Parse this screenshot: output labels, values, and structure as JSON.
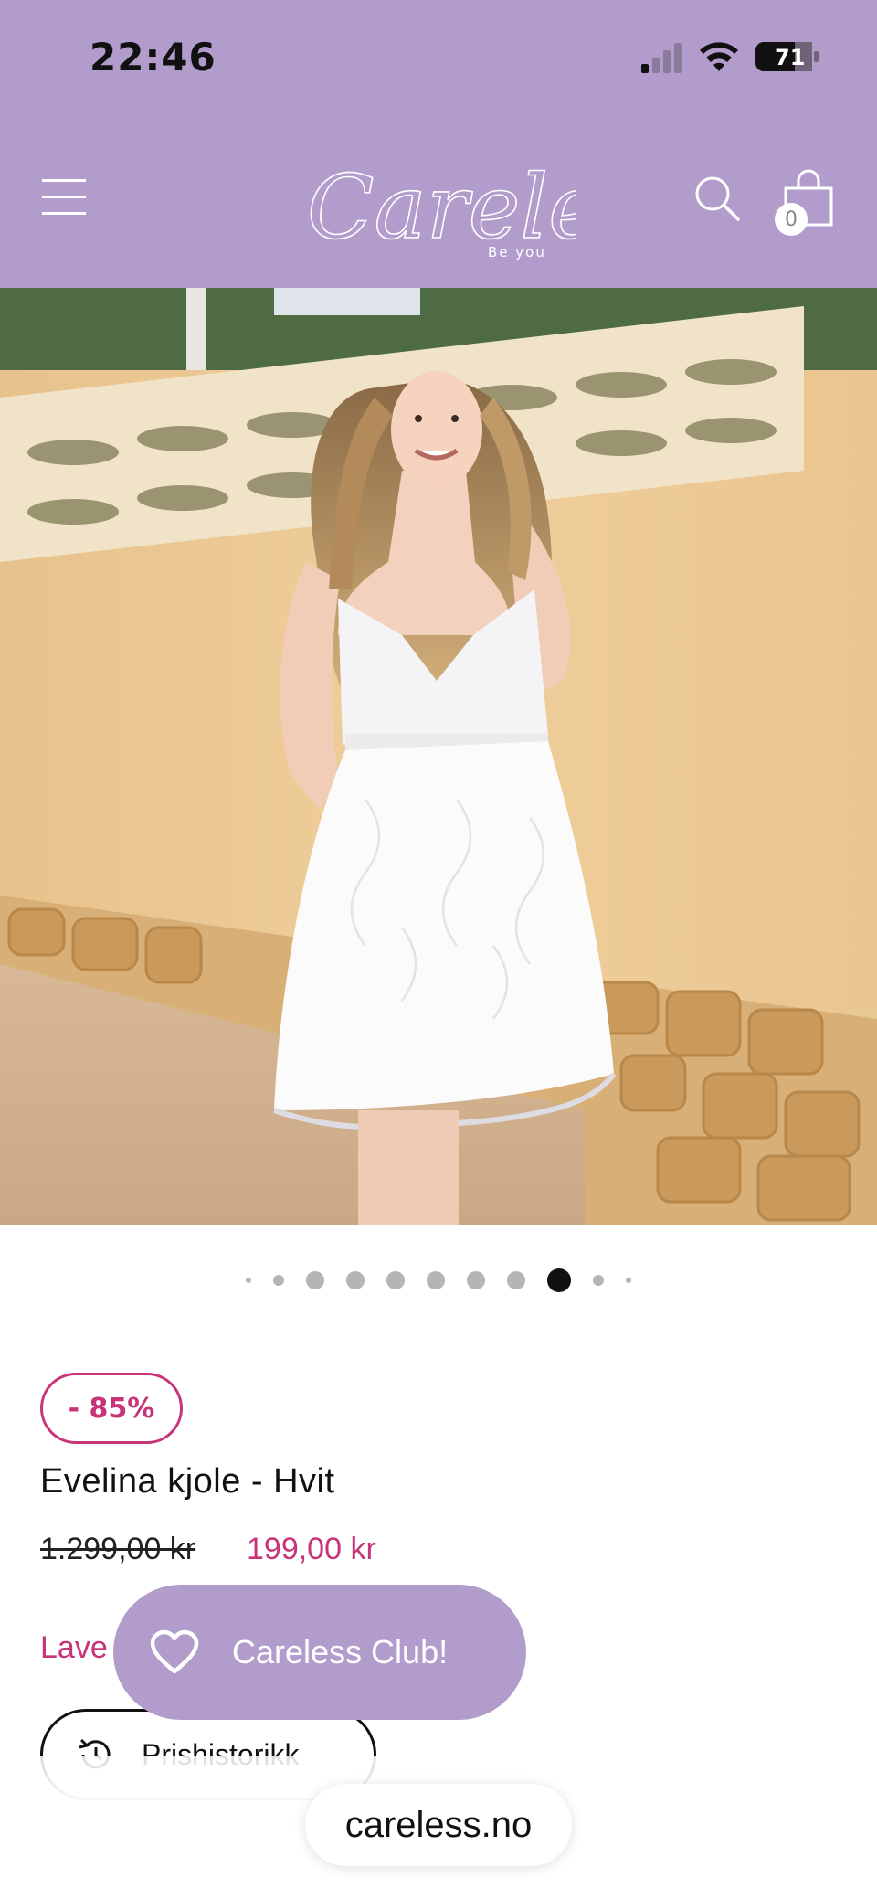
{
  "status_bar": {
    "time": "22:46",
    "battery": "71"
  },
  "header": {
    "logo_text": "Careless",
    "logo_tagline": "Be you",
    "cart_count": "0",
    "background": "#b29ccb"
  },
  "gallery": {
    "total_images": 11,
    "active_index": 8
  },
  "product": {
    "discount_badge": "- 85%",
    "title": "Evelina kjole - Hvit",
    "old_price": "1.299,00 kr",
    "new_price": "199,00 kr",
    "lowest_price_label": "Lave",
    "price_history_label": "Prishistorikk",
    "accent_color": "#c8347a"
  },
  "club": {
    "label": "Careless Club!"
  },
  "browser": {
    "url": "careless.no"
  },
  "icons": [
    "signal-icon",
    "wifi-icon",
    "battery-icon",
    "menu-icon",
    "search-icon",
    "cart-icon",
    "history-icon",
    "heart-icon"
  ]
}
